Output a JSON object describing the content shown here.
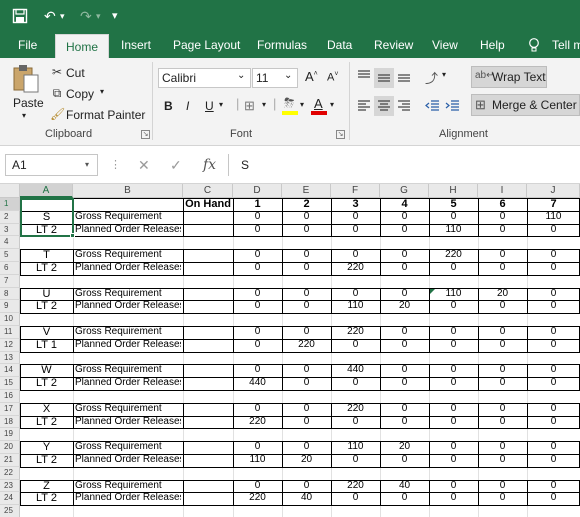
{
  "title_bar": {
    "save_icon": "save-icon",
    "undo_icon": "undo-icon",
    "redo_icon": "redo-icon",
    "customize_icon": "customize-qat-icon"
  },
  "tabs": [
    "File",
    "Home",
    "Insert",
    "Page Layout",
    "Formulas",
    "Data",
    "Review",
    "View",
    "Help"
  ],
  "active_tab": "Home",
  "tell_me": "Tell m",
  "clipboard": {
    "paste": "Paste",
    "cut": "Cut",
    "copy": "Copy",
    "format_painter": "Format Painter",
    "group_label": "Clipboard"
  },
  "font": {
    "name": "Calibri",
    "size": "11",
    "bold": "B",
    "italic": "I",
    "underline": "U",
    "group_label": "Font"
  },
  "alignment": {
    "wrap_text": "Wrap Text",
    "merge_center": "Merge & Center",
    "group_label": "Alignment"
  },
  "formula_bar": {
    "name_box": "A1",
    "fx": "fx",
    "content": "S"
  },
  "columns": [
    "A",
    "B",
    "C",
    "D",
    "E",
    "F",
    "G",
    "H",
    "I",
    "J"
  ],
  "rows": [
    "1",
    "2",
    "3",
    "4",
    "5",
    "6",
    "7",
    "8",
    "9",
    "10",
    "11",
    "12",
    "13",
    "14",
    "15",
    "16",
    "17",
    "18",
    "19",
    "20",
    "21",
    "22",
    "23",
    "24",
    "25"
  ],
  "sheet": {
    "header": {
      "c": "On Hand",
      "periods": [
        "1",
        "2",
        "3",
        "4",
        "5",
        "6",
        "7"
      ]
    },
    "row_label_gross": "Gross Requirement",
    "row_label_planned": "Planned Order Releases",
    "items": [
      {
        "id": "S",
        "lt": "LT 2",
        "gross": [
          "0",
          "0",
          "0",
          "0",
          "0",
          "0",
          "110"
        ],
        "planned": [
          "0",
          "0",
          "0",
          "0",
          "110",
          "0",
          "0"
        ]
      },
      {
        "id": "T",
        "lt": "LT 2",
        "gross": [
          "0",
          "0",
          "0",
          "0",
          "220",
          "0",
          "0"
        ],
        "planned": [
          "0",
          "0",
          "220",
          "0",
          "0",
          "0",
          "0"
        ]
      },
      {
        "id": "U",
        "lt": "LT 2",
        "gross": [
          "0",
          "0",
          "0",
          "0",
          "110",
          "20",
          "0"
        ],
        "planned": [
          "0",
          "0",
          "110",
          "20",
          "0",
          "0",
          "0"
        ]
      },
      {
        "id": "V",
        "lt": "LT 1",
        "gross": [
          "0",
          "0",
          "220",
          "0",
          "0",
          "0",
          "0"
        ],
        "planned": [
          "0",
          "220",
          "0",
          "0",
          "0",
          "0",
          "0"
        ]
      },
      {
        "id": "W",
        "lt": "LT 2",
        "gross": [
          "0",
          "0",
          "440",
          "0",
          "0",
          "0",
          "0"
        ],
        "planned": [
          "440",
          "0",
          "0",
          "0",
          "0",
          "0",
          "0"
        ]
      },
      {
        "id": "X",
        "lt": "LT 2",
        "gross": [
          "0",
          "0",
          "220",
          "0",
          "0",
          "0",
          "0"
        ],
        "planned": [
          "220",
          "0",
          "0",
          "0",
          "0",
          "0",
          "0"
        ]
      },
      {
        "id": "Y",
        "lt": "LT 2",
        "gross": [
          "0",
          "0",
          "110",
          "20",
          "0",
          "0",
          "0"
        ],
        "planned": [
          "110",
          "20",
          "0",
          "0",
          "0",
          "0",
          "0"
        ]
      },
      {
        "id": "Z",
        "lt": "LT 2",
        "gross": [
          "0",
          "0",
          "220",
          "40",
          "0",
          "0",
          "0"
        ],
        "planned": [
          "220",
          "40",
          "0",
          "0",
          "0",
          "0",
          "0"
        ]
      }
    ]
  },
  "colors": {
    "excel_green": "#217346",
    "ribbon_bg": "#f3f3f3"
  }
}
